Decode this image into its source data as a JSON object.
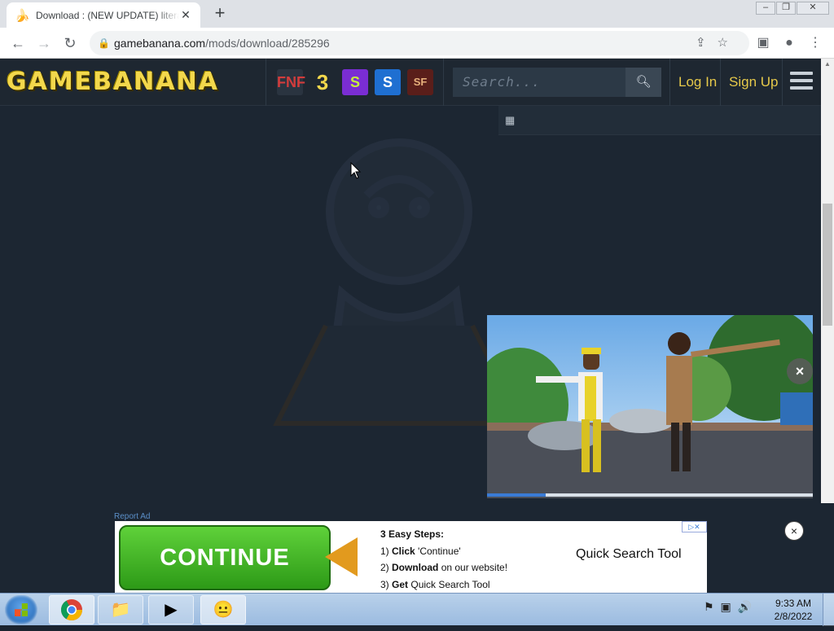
{
  "browser": {
    "tab_title": "Download : (NEW UPDATE) literal",
    "tab_favicon": "banana-icon",
    "new_tab_label": "+",
    "url_domain": "gamebanana.com",
    "url_path": "/mods/download/285296"
  },
  "site": {
    "logo_text": "GAMEBANANA",
    "games": [
      {
        "icon": "fnf-icon",
        "label": "FNF"
      },
      {
        "icon": "3air-icon",
        "label": "3"
      },
      {
        "icon": "splatoon-icon",
        "label": "S"
      },
      {
        "icon": "sonic-icon",
        "label": "S"
      },
      {
        "icon": "sf-icon",
        "label": "SF"
      }
    ],
    "search_placeholder": "Search...",
    "login_label": "Log In",
    "signup_label": "Sign Up"
  },
  "video_ad": {
    "close_label": "×",
    "progress": 0.18
  },
  "bottom_ad": {
    "report_label": "Report Ad",
    "continue_label": "CONTINUE",
    "steps_title": "3 Easy Steps:",
    "step1_bold": "Click",
    "step1_rest": "'Continue'",
    "step1_num": "1)",
    "step2_num": "2)",
    "step2_bold": "Download",
    "step2_rest": "on our website!",
    "step3_num": "3)",
    "step3_bold": "Get",
    "step3_rest": "Quick Search Tool",
    "product_name": "Quick Search Tool",
    "adchoices_label": "▷✕",
    "close_label": "×"
  },
  "taskbar": {
    "time": "9:33 AM",
    "date": "2/8/2022",
    "tasks": [
      "chrome-icon",
      "explorer-icon",
      "media-player-icon",
      "chat-icon"
    ]
  },
  "colors": {
    "accent_yellow": "#f3d84c",
    "header_bg": "#1e2731",
    "continue_green": "#2d9a17"
  }
}
